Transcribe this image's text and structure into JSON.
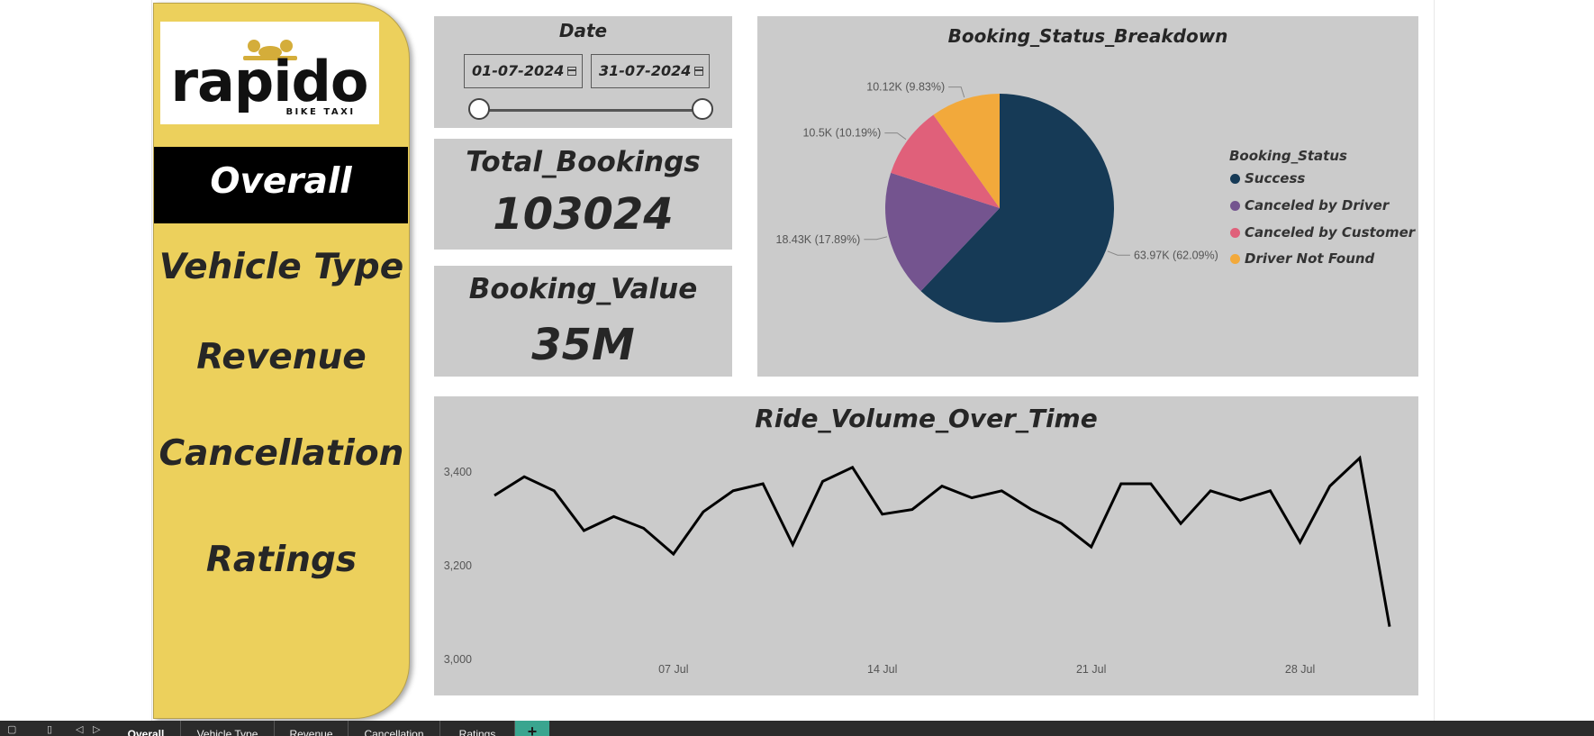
{
  "sidebar": {
    "logo": {
      "brand": "rapido",
      "tagline": "BIKE TAXI"
    },
    "nav": [
      "Overall",
      "Vehicle Type",
      "Revenue",
      "Cancellation",
      "Ratings"
    ],
    "active": "Overall",
    "color": "#ecd05c"
  },
  "date_slicer": {
    "title": "Date",
    "start": "01-07-2024",
    "end": "31-07-2024",
    "range_start_fraction": 0,
    "range_end_fraction": 1
  },
  "kpis": {
    "total_bookings": {
      "title": "Total_Bookings",
      "value": "103024"
    },
    "booking_value": {
      "title": "Booking_Value",
      "value": "35M"
    }
  },
  "pie": {
    "title": "Booking_Status_Breakdown",
    "legend_title": "Booking_Status",
    "slices": [
      {
        "name": "Success",
        "label": "63.97K (62.09%)",
        "percent": 62.09,
        "color": "#163a56"
      },
      {
        "name": "Canceled by Driver",
        "label": "18.43K (17.89%)",
        "percent": 17.89,
        "color": "#74548f"
      },
      {
        "name": "Canceled by Customer",
        "label": "10.5K (10.19%)",
        "percent": 10.19,
        "color": "#e0607a"
      },
      {
        "name": "Driver Not Found",
        "label": "10.12K (9.83%)",
        "percent": 9.83,
        "color": "#f2a93b"
      }
    ]
  },
  "chart_data": {
    "type": "line",
    "title": "Ride_Volume_Over_Time",
    "x": [
      1,
      2,
      3,
      4,
      5,
      6,
      7,
      8,
      9,
      10,
      11,
      12,
      13,
      14,
      15,
      16,
      17,
      18,
      19,
      20,
      21,
      22,
      23,
      24,
      25,
      26,
      27,
      28,
      29,
      30,
      31
    ],
    "x_ticks": [
      {
        "day": 7,
        "label": "07 Jul"
      },
      {
        "day": 14,
        "label": "14 Jul"
      },
      {
        "day": 21,
        "label": "21 Jul"
      },
      {
        "day": 28,
        "label": "28 Jul"
      }
    ],
    "series": [
      {
        "values": [
          3350,
          3390,
          3360,
          3275,
          3305,
          3280,
          3225,
          3315,
          3360,
          3375,
          3245,
          3380,
          3410,
          3310,
          3320,
          3370,
          3345,
          3360,
          3320,
          3290,
          3240,
          3375,
          3375,
          3290,
          3360,
          3340,
          3360,
          3250,
          3370,
          3430,
          3070
        ]
      }
    ],
    "ylim": [
      3000,
      3450
    ],
    "y_ticks": [
      {
        "value": 3000,
        "label": "3,000"
      },
      {
        "value": 3200,
        "label": "3,200"
      },
      {
        "value": 3400,
        "label": "3,400"
      }
    ],
    "grid": false,
    "line_color": "#000000"
  },
  "tabs": {
    "items": [
      "Overall",
      "Vehicle Type",
      "Revenue",
      "Cancellation",
      "Ratings"
    ],
    "active": "Overall",
    "add_label": "+"
  }
}
